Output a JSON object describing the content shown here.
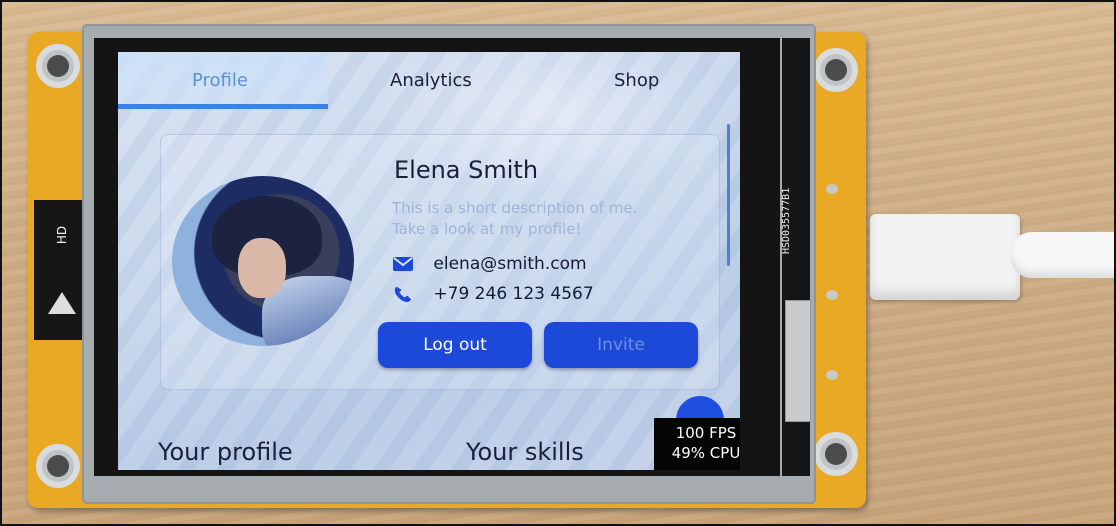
{
  "tabs": {
    "items": [
      {
        "label": "Profile",
        "active": true
      },
      {
        "label": "Analytics",
        "active": false
      },
      {
        "label": "Shop",
        "active": false
      }
    ]
  },
  "profile": {
    "name": "Elena Smith",
    "description_line1": "This is a short description of me.",
    "description_line2": "Take a look at my profile!",
    "email": "elena@smith.com",
    "phone": "+79 246 123 4567",
    "email_icon": "envelope-icon",
    "phone_icon": "phone-icon"
  },
  "buttons": {
    "logout": "Log out",
    "invite": "Invite"
  },
  "sections": {
    "left": "Your profile",
    "right": "Your skills"
  },
  "perf": {
    "fps": "100 FPS",
    "cpu": "49% CPU"
  },
  "board": {
    "model_code": "HSD035577B1",
    "sticker_text": "HD"
  },
  "colors": {
    "accent": "#1d49d8",
    "tab_active": "#5b8fd6",
    "pcb": "#e9a925"
  }
}
